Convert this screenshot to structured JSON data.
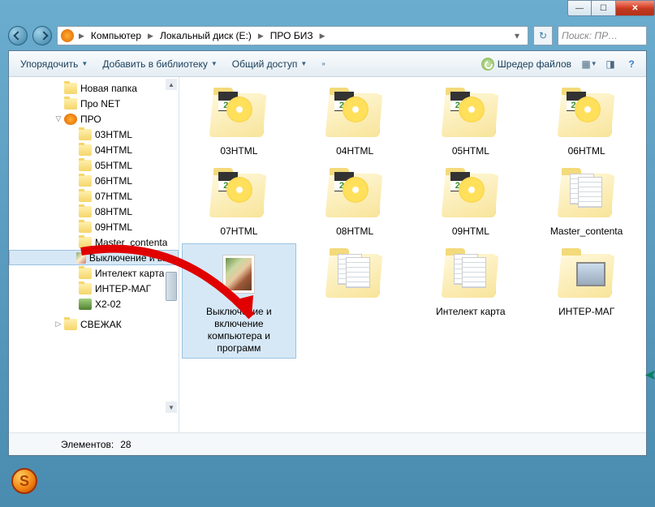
{
  "window": {
    "min_icon": "—",
    "max_icon": "☐",
    "close_icon": "✕"
  },
  "breadcrumb": {
    "segments": [
      "Компьютер",
      "Локальный диск (E:)",
      "ПРО БИЗ"
    ]
  },
  "search": {
    "placeholder": "Поиск: ПР…"
  },
  "toolbar": {
    "organize": "Упорядочить",
    "library": "Добавить в библиотеку",
    "share": "Общий доступ",
    "shredder": "Шредер файлов"
  },
  "tree": {
    "items": [
      {
        "label": "Новая папка",
        "indent": 2,
        "icon": "folder"
      },
      {
        "label": "Про NET",
        "indent": 2,
        "icon": "folder"
      },
      {
        "label": "ПРО",
        "indent": 2,
        "icon": "redball",
        "exp": "�崎"
      },
      {
        "label": "03HTML",
        "indent": 3,
        "icon": "folder"
      },
      {
        "label": "04HTML",
        "indent": 3,
        "icon": "folder"
      },
      {
        "label": "05HTML",
        "indent": 3,
        "icon": "folder"
      },
      {
        "label": "06HTML",
        "indent": 3,
        "icon": "folder"
      },
      {
        "label": "07HTML",
        "indent": 3,
        "icon": "folder"
      },
      {
        "label": "08HTML",
        "indent": 3,
        "icon": "folder"
      },
      {
        "label": "09HTML",
        "indent": 3,
        "icon": "folder"
      },
      {
        "label": "Master_contenta",
        "indent": 3,
        "icon": "folder"
      },
      {
        "label": "Выключение и включение",
        "indent": 3,
        "icon": "pic",
        "selected": true
      },
      {
        "label": "Интелект карта",
        "indent": 3,
        "icon": "folder"
      },
      {
        "label": "ИНТЕР-МАГ",
        "indent": 3,
        "icon": "folder"
      },
      {
        "label": "X2-02",
        "indent": 3,
        "icon": "greenapp"
      },
      {
        "label": "СВЕЖАК",
        "indent": 2,
        "icon": "folder",
        "exp": "▷",
        "sepBefore": true
      }
    ]
  },
  "grid": {
    "items": [
      {
        "label": "03HTML",
        "kind": "disk"
      },
      {
        "label": "04HTML",
        "kind": "disk"
      },
      {
        "label": "05HTML",
        "kind": "disk"
      },
      {
        "label": "06HTML",
        "kind": "disk"
      },
      {
        "label": "07HTML",
        "kind": "disk"
      },
      {
        "label": "08HTML",
        "kind": "disk"
      },
      {
        "label": "09HTML",
        "kind": "disk"
      },
      {
        "label": "Master_contenta",
        "kind": "paper"
      },
      {
        "label": "Выключение и включение компьютера и программ",
        "kind": "portrait",
        "selected": true
      },
      {
        "label": "",
        "kind": "paper"
      },
      {
        "label": "Интелект карта",
        "kind": "paper"
      },
      {
        "label": "ИНТЕР-МАГ",
        "kind": "screen"
      }
    ]
  },
  "status": {
    "count_label": "Элементов:",
    "count_value": "28"
  }
}
